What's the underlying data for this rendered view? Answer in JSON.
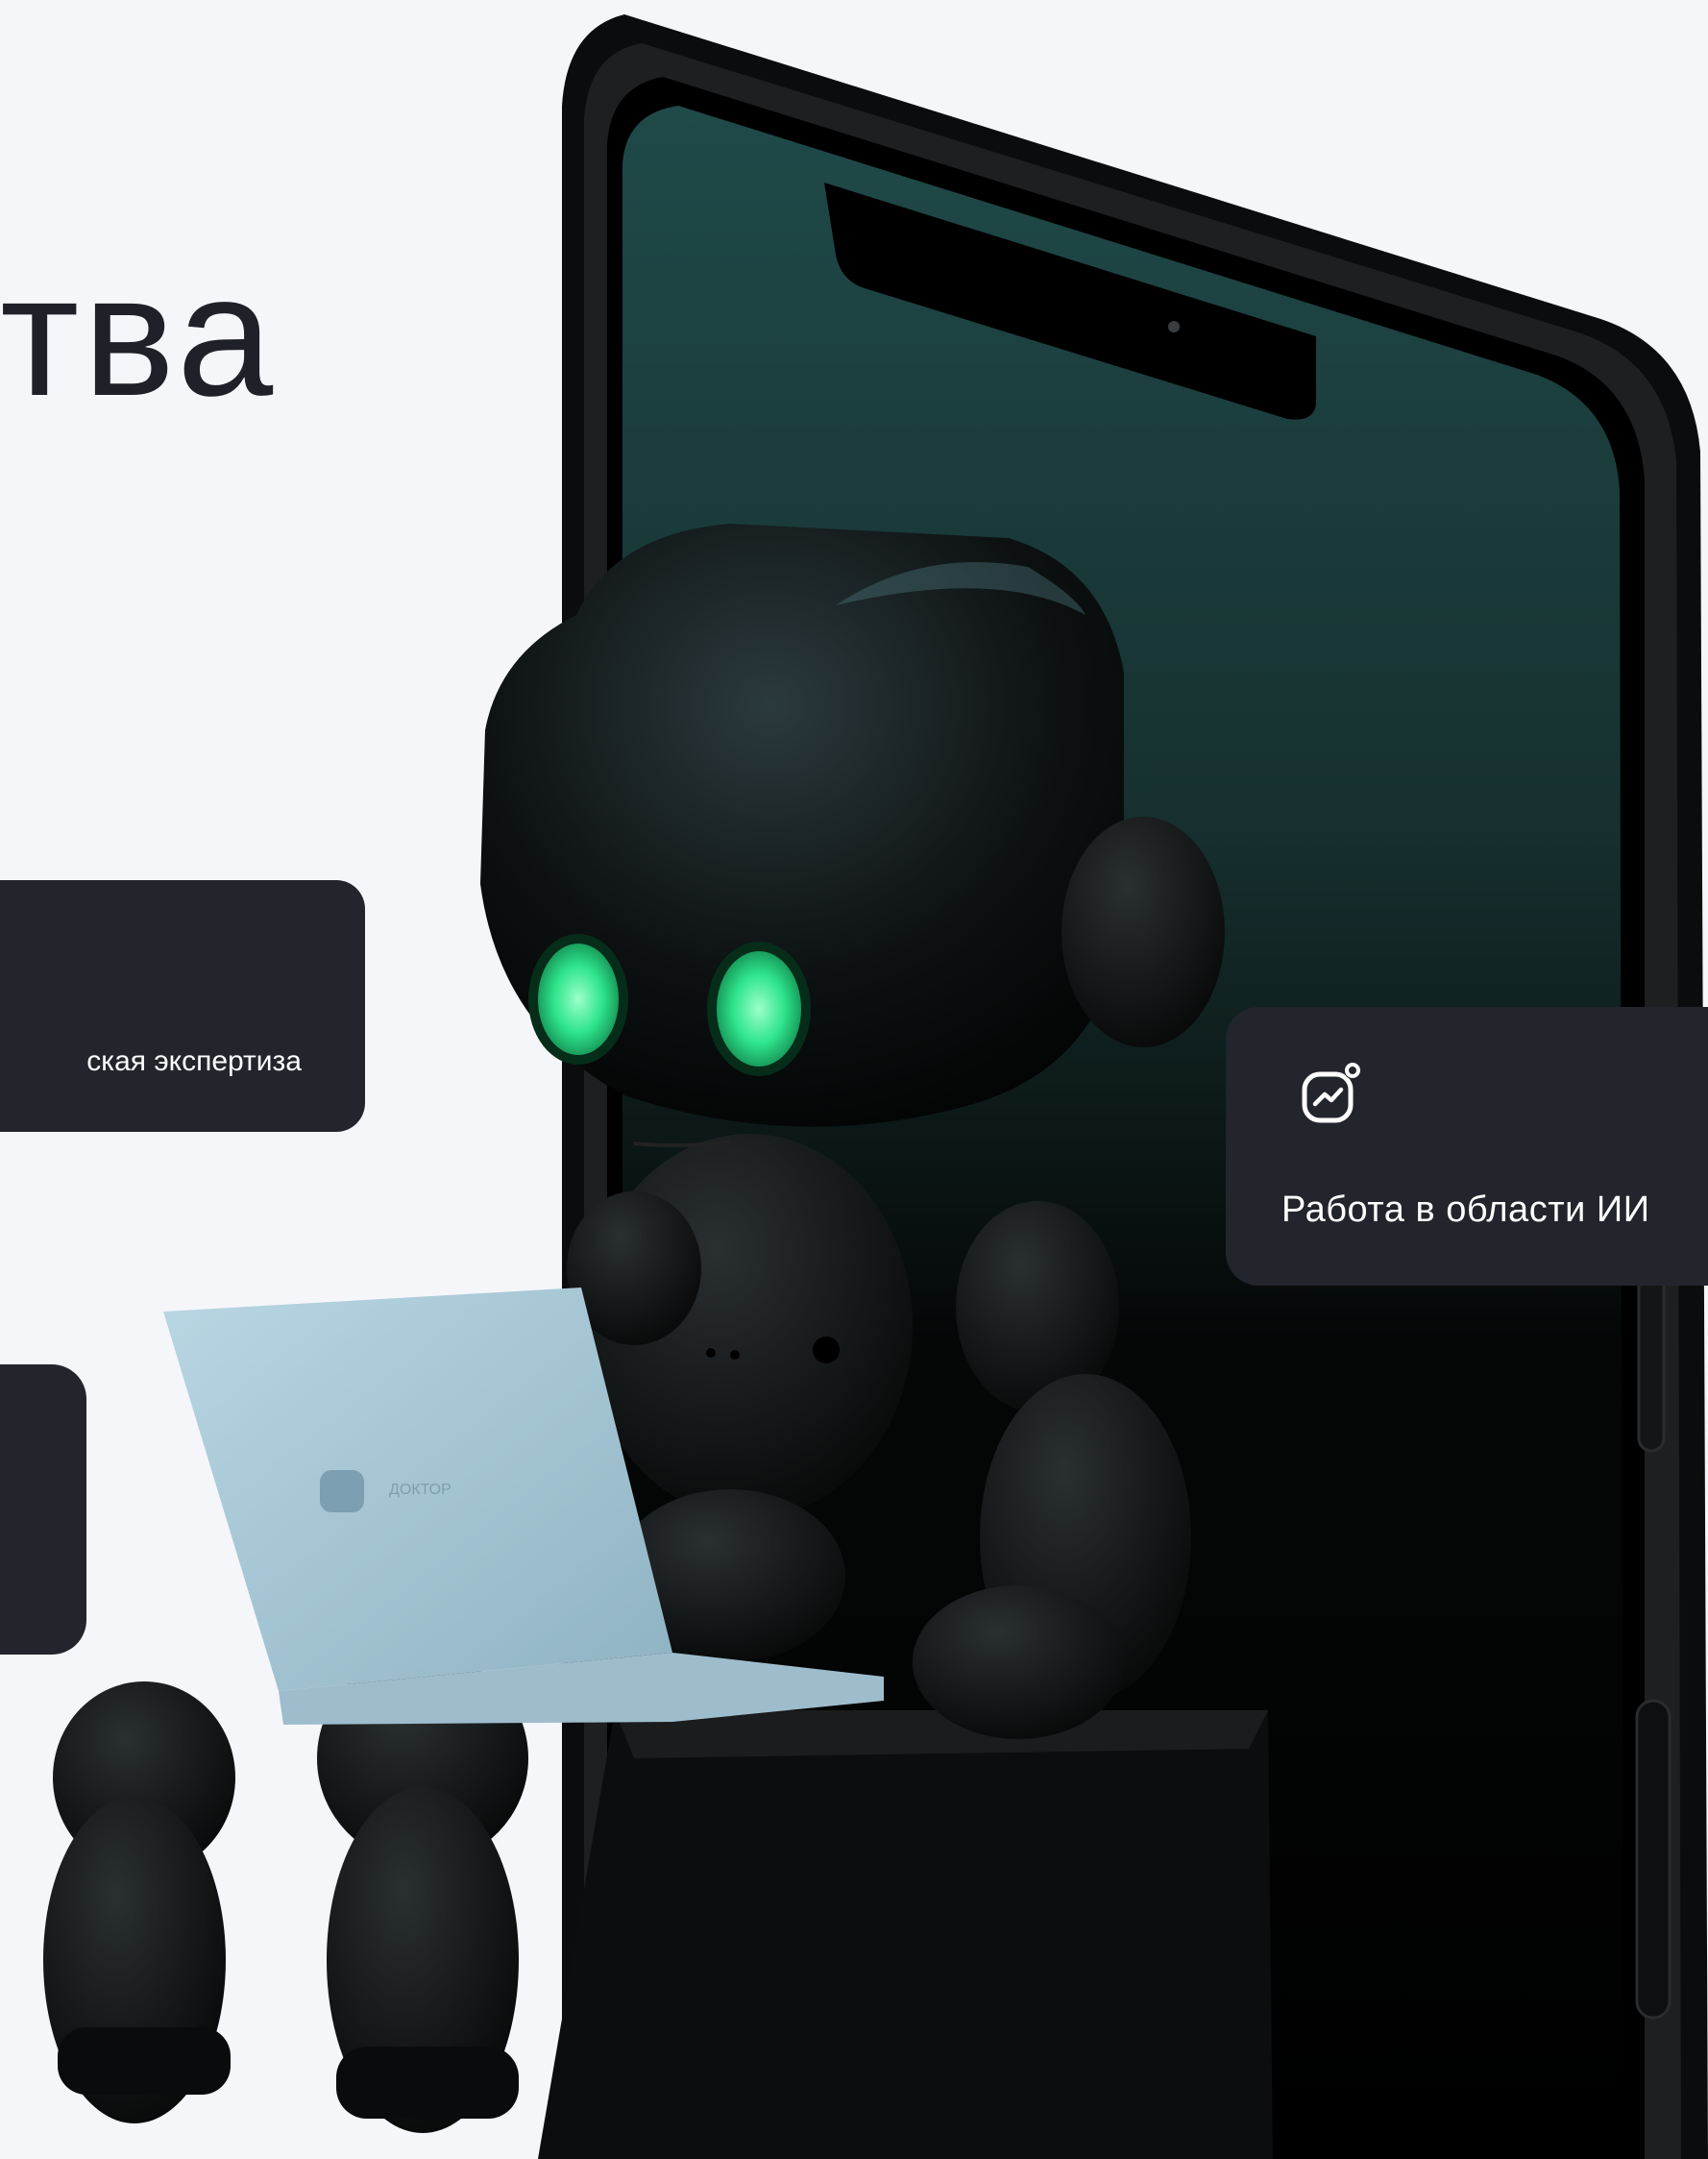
{
  "heading": {
    "text": "тва"
  },
  "cards": [
    {
      "label": "ская экспертиза"
    },
    {
      "label": ""
    },
    {
      "label": "Работа в области ИИ",
      "icon": "trending-chart-icon"
    }
  ],
  "laptop": {
    "logo_text": "ДОКТОР"
  },
  "colors": {
    "background": "#f5f6fa",
    "card": "#22252c",
    "robot_eyes": "#2ee58c",
    "phone_screen_top": "#1f4a49",
    "laptop": "#a9c9d8"
  }
}
